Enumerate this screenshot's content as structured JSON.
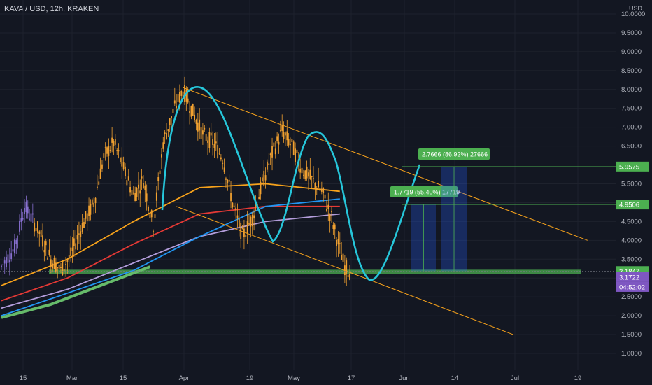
{
  "header": {
    "symbol": "KAVA / USD, 12h, KRAKEN",
    "currency": "USD"
  },
  "colors": {
    "background": "#131722",
    "grid": "#1e222d",
    "text": "#b2b5be",
    "candle": "#f0a030",
    "candle_purple": "#8870d0",
    "trend": "#f7a21b",
    "support": "#4caf50",
    "projection": "#26c6da",
    "price_badge_green": "#4caf50",
    "price_badge_purple": "#7e57c2"
  },
  "chart_data": {
    "type": "line",
    "title": "KAVA / USD, 12h, KRAKEN",
    "ylim": [
      1.0,
      10.0
    ],
    "y_ticks": [
      "10.0000",
      "9.5000",
      "9.0000",
      "8.5000",
      "8.0000",
      "7.5000",
      "7.0000",
      "6.5000",
      "6.0000",
      "5.5000",
      "5.0000",
      "4.5000",
      "4.0000",
      "3.5000",
      "3.0000",
      "2.5000",
      "2.0000",
      "1.5000",
      "1.0000"
    ],
    "x_ticks": [
      "15",
      "Mar",
      "15",
      "Apr",
      "19",
      "May",
      "17",
      "Jun",
      "14",
      "Jul",
      "19"
    ],
    "price_path": [
      {
        "t": 0,
        "p": 3.3
      },
      {
        "t": 8,
        "p": 3.8
      },
      {
        "t": 14,
        "p": 4.9
      },
      {
        "t": 22,
        "p": 4.3
      },
      {
        "t": 30,
        "p": 3.5
      },
      {
        "t": 36,
        "p": 3.2
      },
      {
        "t": 42,
        "p": 3.6
      },
      {
        "t": 48,
        "p": 4.3
      },
      {
        "t": 56,
        "p": 5.0
      },
      {
        "t": 62,
        "p": 6.2
      },
      {
        "t": 68,
        "p": 6.6
      },
      {
        "t": 74,
        "p": 5.9
      },
      {
        "t": 80,
        "p": 5.2
      },
      {
        "t": 86,
        "p": 5.6
      },
      {
        "t": 92,
        "p": 4.4
      },
      {
        "t": 98,
        "p": 6.6
      },
      {
        "t": 104,
        "p": 7.4
      },
      {
        "t": 110,
        "p": 8.0
      },
      {
        "t": 116,
        "p": 7.4
      },
      {
        "t": 122,
        "p": 6.8
      },
      {
        "t": 128,
        "p": 6.6
      },
      {
        "t": 134,
        "p": 6.2
      },
      {
        "t": 140,
        "p": 5.0
      },
      {
        "t": 146,
        "p": 4.1
      },
      {
        "t": 152,
        "p": 4.6
      },
      {
        "t": 158,
        "p": 5.5
      },
      {
        "t": 164,
        "p": 6.3
      },
      {
        "t": 170,
        "p": 6.9
      },
      {
        "t": 176,
        "p": 6.5
      },
      {
        "t": 182,
        "p": 5.9
      },
      {
        "t": 188,
        "p": 5.6
      },
      {
        "t": 194,
        "p": 5.3
      },
      {
        "t": 200,
        "p": 4.6
      },
      {
        "t": 204,
        "p": 3.9
      },
      {
        "t": 208,
        "p": 3.3
      },
      {
        "t": 211,
        "p": 3.17
      }
    ],
    "moving_averages": [
      {
        "color": "#f7a21b",
        "points": [
          {
            "t": 0,
            "p": 2.8
          },
          {
            "t": 40,
            "p": 3.5
          },
          {
            "t": 80,
            "p": 4.5
          },
          {
            "t": 120,
            "p": 5.4
          },
          {
            "t": 160,
            "p": 5.5
          },
          {
            "t": 205,
            "p": 5.3
          }
        ]
      },
      {
        "color": "#e53935",
        "points": [
          {
            "t": 0,
            "p": 2.4
          },
          {
            "t": 40,
            "p": 3.0
          },
          {
            "t": 80,
            "p": 3.9
          },
          {
            "t": 120,
            "p": 4.7
          },
          {
            "t": 160,
            "p": 4.9
          },
          {
            "t": 205,
            "p": 4.9
          }
        ]
      },
      {
        "color": "#b39ddb",
        "points": [
          {
            "t": 0,
            "p": 2.2
          },
          {
            "t": 40,
            "p": 2.7
          },
          {
            "t": 80,
            "p": 3.4
          },
          {
            "t": 120,
            "p": 4.1
          },
          {
            "t": 160,
            "p": 4.5
          },
          {
            "t": 205,
            "p": 4.7
          }
        ]
      },
      {
        "color": "#2196f3",
        "points": [
          {
            "t": 0,
            "p": 2.0
          },
          {
            "t": 40,
            "p": 2.6
          },
          {
            "t": 80,
            "p": 3.2
          },
          {
            "t": 120,
            "p": 4.1
          },
          {
            "t": 160,
            "p": 4.9
          },
          {
            "t": 205,
            "p": 5.1
          }
        ]
      },
      {
        "color": "#66bb6a",
        "points": [
          {
            "t": 0,
            "p": 1.95
          },
          {
            "t": 30,
            "p": 2.3
          },
          {
            "t": 60,
            "p": 2.8
          },
          {
            "t": 90,
            "p": 3.3
          }
        ]
      }
    ],
    "trendlines": [
      {
        "name": "upper",
        "from": {
          "t": 110,
          "p": 8.05
        },
        "to": {
          "t": 355,
          "p": 4.0
        }
      },
      {
        "name": "lower",
        "from": {
          "t": 106,
          "p": 4.9
        },
        "to": {
          "t": 310,
          "p": 1.5
        }
      }
    ],
    "support_zone": [
      3.1,
      3.22
    ],
    "levels": [
      {
        "price": 5.9575,
        "label": "5.9575",
        "color": "#4caf50"
      },
      {
        "price": 4.9506,
        "label": "4.9506",
        "color": "#4caf50"
      },
      {
        "price": 3.1847,
        "label": "3.1847",
        "color": "#4caf50"
      },
      {
        "price": 3.1722,
        "label": "3.1722",
        "color": "#7e57c2"
      }
    ],
    "countdown": "04:52:02",
    "projections": [
      {
        "label": "1.7719 (55.40%) 17719",
        "base": 3.18,
        "target": 4.95
      },
      {
        "label": "2.7666 (86.92%) 27666",
        "base": 3.18,
        "target": 5.95
      }
    ]
  }
}
